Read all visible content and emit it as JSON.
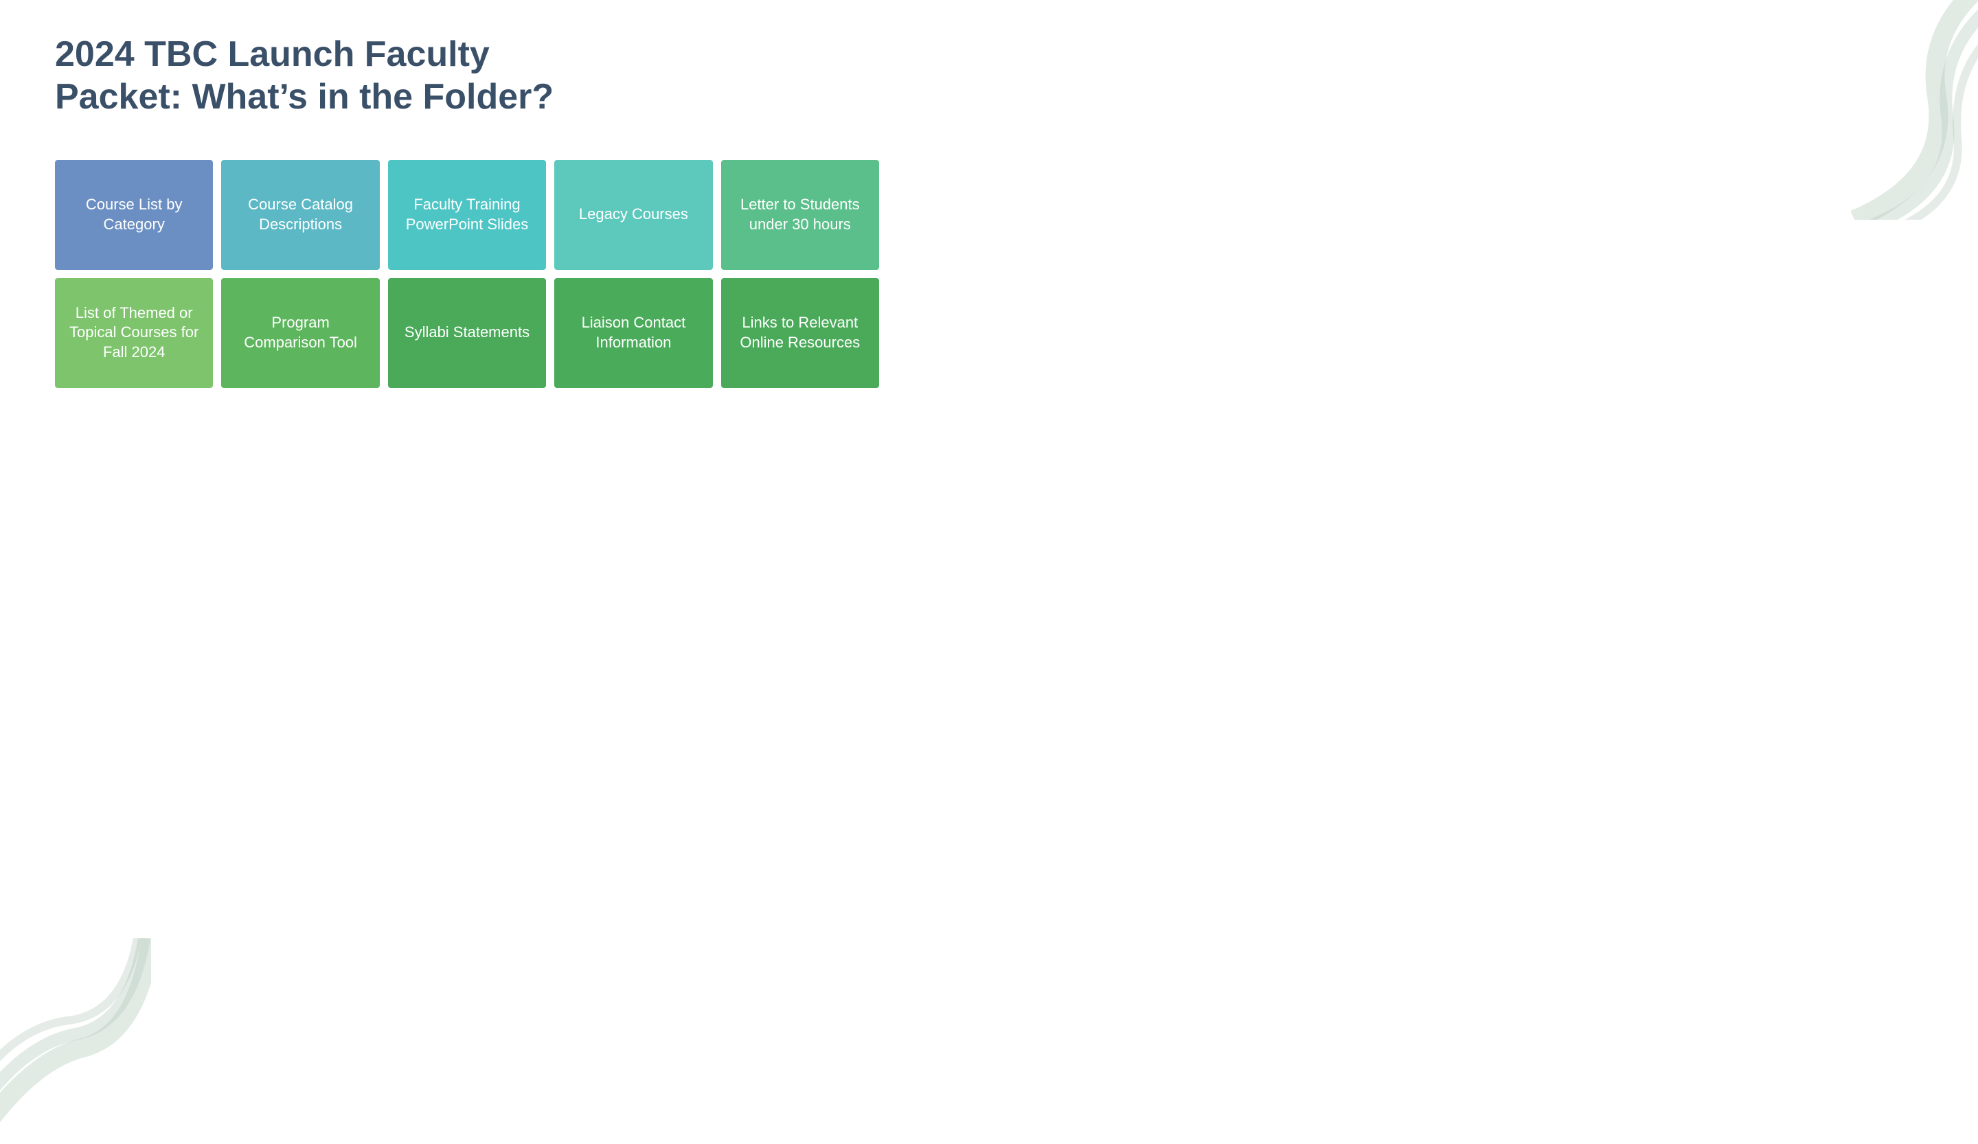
{
  "page": {
    "title": "2024 TBC Launch Faculty Packet: What’s in the Folder?"
  },
  "row1": [
    {
      "id": "course-list-by-category",
      "label": "Course List by Category",
      "color": "tile-blue"
    },
    {
      "id": "course-catalog-descriptions",
      "label": "Course Catalog Descriptions",
      "color": "tile-teal-1"
    },
    {
      "id": "faculty-training-powerpoint-slides",
      "label": "Faculty Training PowerPoint Slides",
      "color": "tile-teal-2"
    },
    {
      "id": "legacy-courses",
      "label": "Legacy Courses",
      "color": "tile-teal-3"
    },
    {
      "id": "letter-to-students",
      "label": "Letter to Students under 30 hours",
      "color": "tile-green-1"
    }
  ],
  "row2": [
    {
      "id": "list-themed-topical-courses",
      "label": "List of Themed or Topical Courses for Fall 2024",
      "color": "tile-green-lt"
    },
    {
      "id": "program-comparison-tool",
      "label": "Program Comparison Tool",
      "color": "tile-green-med"
    },
    {
      "id": "syllabi-statements",
      "label": "Syllabi Statements",
      "color": "tile-green-dk"
    },
    {
      "id": "liaison-contact-information",
      "label": "Liaison Contact Information",
      "color": "tile-green-dk2"
    },
    {
      "id": "links-to-relevant-online-resources",
      "label": "Links to Relevant Online Resources",
      "color": "tile-green-dk3"
    }
  ]
}
